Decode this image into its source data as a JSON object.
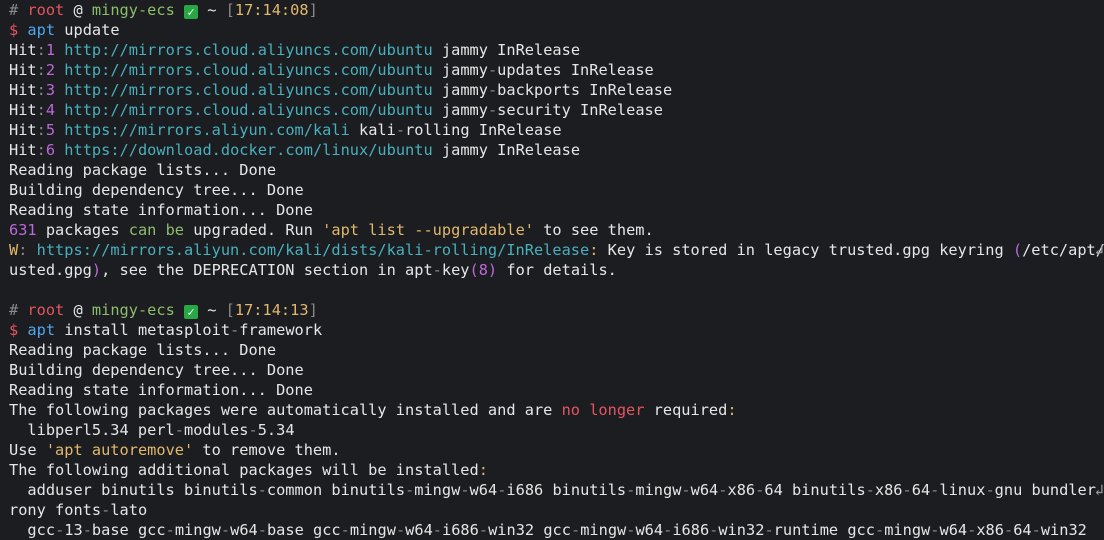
{
  "colors": {
    "background": "#1b1d21",
    "default": "#e6e6e6",
    "dim": "#8a8a8a",
    "red": "#e55561",
    "green": "#8ebd6b",
    "yellow": "#e2b86b",
    "blue": "#4fa6ed",
    "magenta": "#bf68d9",
    "cyan": "#48b0bd",
    "check": "#28a745"
  },
  "lines": [
    [
      [
        "dim",
        "# "
      ],
      [
        "red",
        "root"
      ],
      [
        "default",
        " @ "
      ],
      [
        "green",
        "mingy-ecs"
      ],
      [
        "default",
        " "
      ],
      [
        "check",
        "✓"
      ],
      [
        "default",
        " ~ "
      ],
      [
        "dim",
        "["
      ],
      [
        "yellow",
        "17:14:08"
      ],
      [
        "dim",
        "]"
      ]
    ],
    [
      [
        "red",
        "$ "
      ],
      [
        "blue",
        "apt"
      ],
      [
        "default",
        " update"
      ]
    ],
    [
      [
        "default",
        "Hit"
      ],
      [
        "dim",
        ":"
      ],
      [
        "magenta",
        "1"
      ],
      [
        "default",
        " "
      ],
      [
        "cyan",
        "http://mirrors.cloud.aliyuncs.com/ubuntu"
      ],
      [
        "default",
        " jammy InRelease"
      ]
    ],
    [
      [
        "default",
        "Hit"
      ],
      [
        "dim",
        ":"
      ],
      [
        "magenta",
        "2"
      ],
      [
        "default",
        " "
      ],
      [
        "cyan",
        "http://mirrors.cloud.aliyuncs.com/ubuntu"
      ],
      [
        "default",
        " jammy"
      ],
      [
        "dim",
        "-"
      ],
      [
        "default",
        "updates InRelease"
      ]
    ],
    [
      [
        "default",
        "Hit"
      ],
      [
        "dim",
        ":"
      ],
      [
        "magenta",
        "3"
      ],
      [
        "default",
        " "
      ],
      [
        "cyan",
        "http://mirrors.cloud.aliyuncs.com/ubuntu"
      ],
      [
        "default",
        " jammy"
      ],
      [
        "dim",
        "-"
      ],
      [
        "default",
        "backports InRelease"
      ]
    ],
    [
      [
        "default",
        "Hit"
      ],
      [
        "dim",
        ":"
      ],
      [
        "magenta",
        "4"
      ],
      [
        "default",
        " "
      ],
      [
        "cyan",
        "http://mirrors.cloud.aliyuncs.com/ubuntu"
      ],
      [
        "default",
        " jammy"
      ],
      [
        "dim",
        "-"
      ],
      [
        "default",
        "security InRelease"
      ]
    ],
    [
      [
        "default",
        "Hit"
      ],
      [
        "dim",
        ":"
      ],
      [
        "magenta",
        "5"
      ],
      [
        "default",
        " "
      ],
      [
        "cyan",
        "https://mirrors.aliyun.com/kali"
      ],
      [
        "default",
        " kali"
      ],
      [
        "dim",
        "-"
      ],
      [
        "default",
        "rolling InRelease"
      ]
    ],
    [
      [
        "default",
        "Hit"
      ],
      [
        "dim",
        ":"
      ],
      [
        "magenta",
        "6"
      ],
      [
        "default",
        " "
      ],
      [
        "cyan",
        "https://download.docker.com/linux/ubuntu"
      ],
      [
        "default",
        " jammy InRelease"
      ]
    ],
    [
      [
        "default",
        "Reading package lists... Done"
      ]
    ],
    [
      [
        "default",
        "Building dependency tree... Done"
      ]
    ],
    [
      [
        "default",
        "Reading state information... Done"
      ]
    ],
    [
      [
        "magenta",
        "631"
      ],
      [
        "default",
        " packages "
      ],
      [
        "green",
        "can be"
      ],
      [
        "default",
        " upgraded. Run "
      ],
      [
        "yellow",
        "'apt list --upgradable'"
      ],
      [
        "default",
        " to see them."
      ]
    ],
    [
      [
        "yellow",
        "W"
      ],
      [
        "dim",
        ": "
      ],
      [
        "cyan",
        "https://mirrors.aliyun.com/kali/dists/kali-rolling/InRelease"
      ],
      [
        "yellow",
        ":"
      ],
      [
        "default",
        " Key is stored in legacy trusted.gpg keyring "
      ],
      [
        "magenta",
        "("
      ],
      [
        "default",
        "/etc/apt/tr"
      ]
    ],
    [
      [
        "default",
        "usted.gpg"
      ],
      [
        "magenta",
        ")"
      ],
      [
        "default",
        ", see the DEPRECATION section in apt"
      ],
      [
        "dim",
        "-"
      ],
      [
        "default",
        "key"
      ],
      [
        "magenta",
        "(8)"
      ],
      [
        "default",
        " for details."
      ]
    ],
    [
      [
        "default",
        " "
      ]
    ],
    [
      [
        "dim",
        "# "
      ],
      [
        "red",
        "root"
      ],
      [
        "default",
        " @ "
      ],
      [
        "green",
        "mingy-ecs"
      ],
      [
        "default",
        " "
      ],
      [
        "check",
        "✓"
      ],
      [
        "default",
        " ~ "
      ],
      [
        "dim",
        "["
      ],
      [
        "yellow",
        "17:14:13"
      ],
      [
        "dim",
        "]"
      ]
    ],
    [
      [
        "red",
        "$ "
      ],
      [
        "blue",
        "apt"
      ],
      [
        "default",
        " install metasploit"
      ],
      [
        "dim",
        "-"
      ],
      [
        "default",
        "framework"
      ]
    ],
    [
      [
        "default",
        "Reading package lists... Done"
      ]
    ],
    [
      [
        "default",
        "Building dependency tree... Done"
      ]
    ],
    [
      [
        "default",
        "Reading state information... Done"
      ]
    ],
    [
      [
        "default",
        "The following packages were automatically installed and are "
      ],
      [
        "red",
        "no longer"
      ],
      [
        "default",
        " required"
      ],
      [
        "yellow",
        ":"
      ]
    ],
    [
      [
        "default",
        "  libperl5.34 perl"
      ],
      [
        "dim",
        "-"
      ],
      [
        "default",
        "modules"
      ],
      [
        "dim",
        "-"
      ],
      [
        "default",
        "5.34"
      ]
    ],
    [
      [
        "default",
        "Use "
      ],
      [
        "yellow",
        "'apt autoremove'"
      ],
      [
        "default",
        " to remove them."
      ]
    ],
    [
      [
        "default",
        "The following additional packages will be installed"
      ],
      [
        "yellow",
        ":"
      ]
    ],
    [
      [
        "default",
        "  adduser binutils binutils"
      ],
      [
        "dim",
        "-"
      ],
      [
        "default",
        "common binutils"
      ],
      [
        "dim",
        "-"
      ],
      [
        "default",
        "mingw"
      ],
      [
        "dim",
        "-"
      ],
      [
        "default",
        "w64"
      ],
      [
        "dim",
        "-"
      ],
      [
        "default",
        "i686 binutils"
      ],
      [
        "dim",
        "-"
      ],
      [
        "default",
        "mingw"
      ],
      [
        "dim",
        "-"
      ],
      [
        "default",
        "w64"
      ],
      [
        "dim",
        "-"
      ],
      [
        "default",
        "x86"
      ],
      [
        "dim",
        "-"
      ],
      [
        "default",
        "64 binutils"
      ],
      [
        "dim",
        "-"
      ],
      [
        "default",
        "x86"
      ],
      [
        "dim",
        "-"
      ],
      [
        "default",
        "64"
      ],
      [
        "dim",
        "-"
      ],
      [
        "default",
        "linux"
      ],
      [
        "dim",
        "-"
      ],
      [
        "default",
        "gnu bundler ch"
      ]
    ],
    [
      [
        "default",
        "rony fonts"
      ],
      [
        "dim",
        "-"
      ],
      [
        "default",
        "lato"
      ]
    ],
    [
      [
        "default",
        "  gcc"
      ],
      [
        "dim",
        "-"
      ],
      [
        "default",
        "13"
      ],
      [
        "dim",
        "-"
      ],
      [
        "default",
        "base gcc"
      ],
      [
        "dim",
        "-"
      ],
      [
        "default",
        "mingw"
      ],
      [
        "dim",
        "-"
      ],
      [
        "default",
        "w64"
      ],
      [
        "dim",
        "-"
      ],
      [
        "default",
        "base gcc"
      ],
      [
        "dim",
        "-"
      ],
      [
        "default",
        "mingw"
      ],
      [
        "dim",
        "-"
      ],
      [
        "default",
        "w64"
      ],
      [
        "dim",
        "-"
      ],
      [
        "default",
        "i686"
      ],
      [
        "dim",
        "-"
      ],
      [
        "default",
        "win32 gcc"
      ],
      [
        "dim",
        "-"
      ],
      [
        "default",
        "mingw"
      ],
      [
        "dim",
        "-"
      ],
      [
        "default",
        "w64"
      ],
      [
        "dim",
        "-"
      ],
      [
        "default",
        "i686"
      ],
      [
        "dim",
        "-"
      ],
      [
        "default",
        "win32"
      ],
      [
        "dim",
        "-"
      ],
      [
        "default",
        "runtime gcc"
      ],
      [
        "dim",
        "-"
      ],
      [
        "default",
        "mingw"
      ],
      [
        "dim",
        "-"
      ],
      [
        "default",
        "w64"
      ],
      [
        "dim",
        "-"
      ],
      [
        "default",
        "x86"
      ],
      [
        "dim",
        "-"
      ],
      [
        "default",
        "64"
      ],
      [
        "dim",
        "-"
      ],
      [
        "default",
        "win32"
      ]
    ]
  ],
  "wrap_marker": "↲",
  "wrapped_lines": [
    12,
    24
  ]
}
